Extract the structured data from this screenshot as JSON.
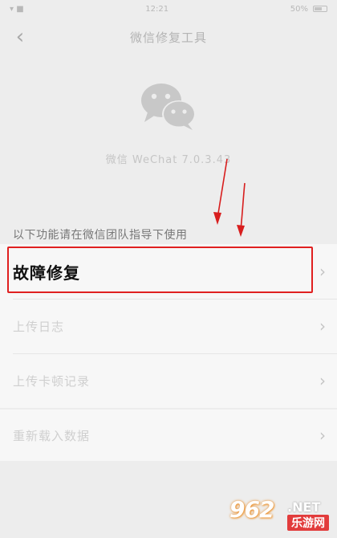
{
  "status_bar": {
    "time": "12:21",
    "signal": "▾ ■",
    "battery_text": "50%"
  },
  "nav": {
    "back_glyph": "‹",
    "title": "微信修复工具"
  },
  "app": {
    "logo_icon": "wechat-logo-icon",
    "version": "微信 WeChat 7.0.3.43"
  },
  "hint": "以下功能请在微信团队指导下使用",
  "group_1": {
    "items": [
      {
        "label": "故障修复",
        "chevron": "›"
      },
      {
        "label": "上传日志",
        "chevron": "›"
      },
      {
        "label": "上传卡顿记录",
        "chevron": "›"
      }
    ]
  },
  "group_2": {
    "items": [
      {
        "label": "重新载入数据",
        "chevron": "›"
      }
    ]
  },
  "watermark": {
    "number": "962",
    "net": ".NET",
    "sub": "乐游网"
  },
  "colors": {
    "background": "#ededed",
    "highlight": "#e02020",
    "row_bg": "#f7f7f7"
  }
}
